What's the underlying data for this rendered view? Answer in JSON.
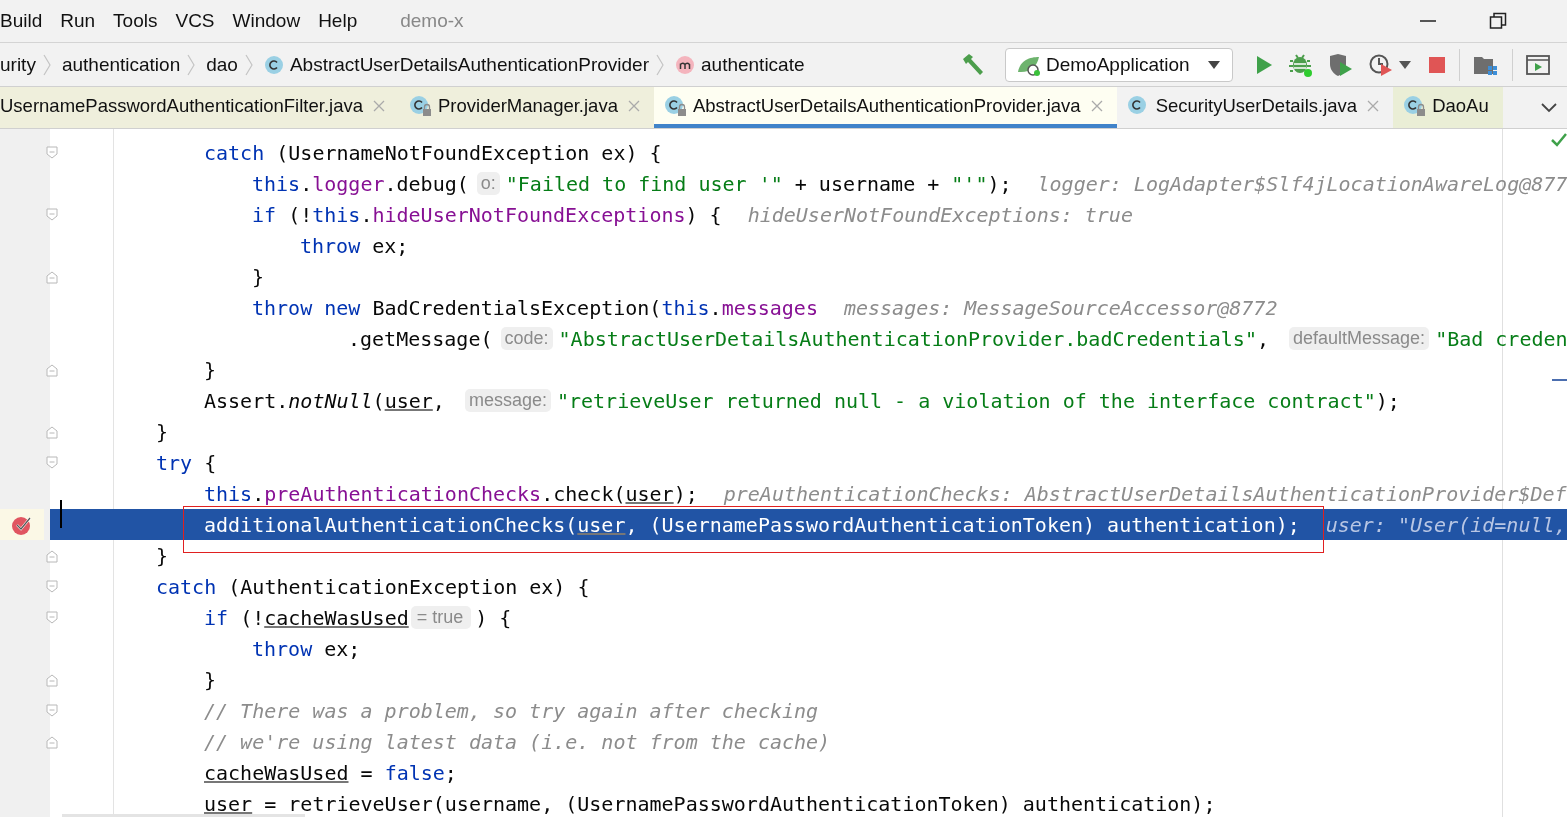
{
  "menu": {
    "items": [
      "Build",
      "Run",
      "Tools",
      "VCS",
      "Window",
      "Help"
    ],
    "project": "demo-x"
  },
  "breadcrumbs": [
    {
      "label": "urity",
      "kind": "package"
    },
    {
      "label": "authentication",
      "kind": "package"
    },
    {
      "label": "dao",
      "kind": "package"
    },
    {
      "label": "AbstractUserDetailsAuthenticationProvider",
      "kind": "class"
    },
    {
      "label": "authenticate",
      "kind": "method"
    }
  ],
  "run_config": "DemoApplication",
  "tabs": [
    {
      "label": "UsernamePasswordAuthenticationFilter.java",
      "selected": false,
      "locked": false,
      "icon": false,
      "color": "#efefdc"
    },
    {
      "label": "ProviderManager.java",
      "selected": false,
      "locked": true,
      "icon": true,
      "color": "#efefdc"
    },
    {
      "label": "AbstractUserDetailsAuthenticationProvider.java",
      "selected": true,
      "locked": true,
      "icon": true,
      "color": "#fefef2"
    },
    {
      "label": "SecurityUserDetails.java",
      "selected": false,
      "locked": false,
      "icon": true,
      "color": "#f2f2f2"
    },
    {
      "label": "DaoAu",
      "selected": false,
      "locked": true,
      "icon": true,
      "color": "#eaeed6"
    }
  ],
  "code": {
    "inner_lines": [
      {
        "foldable": true,
        "tokens": [
          {
            "kind": "keyword",
            "text": "catch"
          },
          {
            "kind": "plain",
            "text": " (UsernameNotFoundException ex) {"
          }
        ],
        "children": [
          {
            "tokens": [
              {
                "kind": "keyword",
                "text": "this"
              },
              {
                "kind": "plain",
                "text": "."
              },
              {
                "kind": "field",
                "text": "logger"
              },
              {
                "kind": "plain",
                "text": ".debug("
              },
              {
                "kind": "param_hint",
                "text": "o:"
              },
              {
                "kind": "string",
                "text": "\"Failed to find user '\""
              },
              {
                "kind": "plain",
                "text": " + username + "
              },
              {
                "kind": "string",
                "text": "\"'\""
              },
              {
                "kind": "plain",
                "text": ");"
              },
              {
                "kind": "debug_value",
                "text": "logger: LogAdapter$Slf4jLocationAwareLog@877"
              }
            ]
          },
          {
            "foldable": true,
            "tokens": [
              {
                "kind": "keyword",
                "text": "if"
              },
              {
                "kind": "plain",
                "text": " (!"
              },
              {
                "kind": "keyword",
                "text": "this"
              },
              {
                "kind": "plain",
                "text": "."
              },
              {
                "kind": "field",
                "text": "hideUserNotFoundExceptions"
              },
              {
                "kind": "plain",
                "text": ") {"
              },
              {
                "kind": "debug_value",
                "text": "hideUserNotFoundExceptions: true"
              }
            ],
            "children": [
              {
                "tokens": [
                  {
                    "kind": "keyword",
                    "text": "throw"
                  },
                  {
                    "kind": "plain",
                    "text": " ex;"
                  }
                ]
              }
            ]
          },
          {
            "block_end": true,
            "tokens": [
              {
                "kind": "plain",
                "text": "}"
              }
            ]
          },
          {
            "tokens": [
              {
                "kind": "keyword",
                "text": "throw new"
              },
              {
                "kind": "plain",
                "text": " BadCredentialsException("
              },
              {
                "kind": "keyword",
                "text": "this"
              },
              {
                "kind": "plain",
                "text": "."
              },
              {
                "kind": "field",
                "text": "messages"
              },
              {
                "kind": "debug_value",
                "text": "messages: MessageSourceAccessor@8772"
              }
            ],
            "children": [
              {
                "continuation": true,
                "tokens": [
                  {
                    "kind": "plain",
                    "text": ".getMessage("
                  },
                  {
                    "kind": "param_hint",
                    "text": "code:"
                  },
                  {
                    "kind": "string",
                    "text": "\"AbstractUserDetailsAuthenticationProvider.badCredentials\""
                  },
                  {
                    "kind": "plain",
                    "text": ", "
                  },
                  {
                    "kind": "param_hint",
                    "text": "defaultMessage:"
                  },
                  {
                    "kind": "string",
                    "text": "\"Bad creden"
                  }
                ]
              }
            ]
          }
        ]
      },
      {
        "block_end": true,
        "tokens": [
          {
            "kind": "plain",
            "text": "}"
          }
        ]
      },
      {
        "tokens": [
          {
            "kind": "plain",
            "text": "Assert."
          },
          {
            "kind": "static",
            "text": "notNull"
          },
          {
            "kind": "plain",
            "text": "("
          },
          {
            "kind": "local",
            "text": "user"
          },
          {
            "kind": "plain",
            "text": ", "
          },
          {
            "kind": "param_hint",
            "text": "message:"
          },
          {
            "kind": "string",
            "text": "\"retrieveUser returned null - a violation of the interface contract\""
          },
          {
            "kind": "plain",
            "text": ");"
          }
        ]
      }
    ],
    "lines": [
      {
        "block_end": true,
        "tokens": [
          {
            "kind": "plain",
            "text": "}"
          }
        ]
      },
      {
        "foldable": true,
        "tokens": [
          {
            "kind": "keyword",
            "text": "try"
          },
          {
            "kind": "plain",
            "text": " {"
          }
        ],
        "children": [
          {
            "tokens": [
              {
                "kind": "keyword",
                "text": "this"
              },
              {
                "kind": "plain",
                "text": "."
              },
              {
                "kind": "field",
                "text": "preAuthenticationChecks"
              },
              {
                "kind": "plain",
                "text": ".check("
              },
              {
                "kind": "local",
                "text": "user"
              },
              {
                "kind": "plain",
                "text": ");"
              },
              {
                "kind": "debug_value",
                "text": "preAuthenticationChecks: AbstractUserDetailsAuthenticationProvider$Def"
              }
            ]
          },
          {
            "selected": true,
            "breakpoint": true,
            "boxed": true,
            "tokens": [
              {
                "kind": "plain",
                "text": "additionalAuthenticationChecks("
              },
              {
                "kind": "local",
                "text": "user"
              },
              {
                "kind": "plain",
                "text": ", (UsernamePasswordAuthenticationToken) authentication);"
              },
              {
                "kind": "debug_value",
                "text": "user: \"User(id=null,"
              }
            ]
          }
        ]
      },
      {
        "block_end": true,
        "tokens": [
          {
            "kind": "plain",
            "text": "}"
          }
        ]
      },
      {
        "foldable": true,
        "tokens": [
          {
            "kind": "keyword",
            "text": "catch"
          },
          {
            "kind": "plain",
            "text": " (AuthenticationException ex) {"
          }
        ],
        "children": [
          {
            "foldable": true,
            "tokens": [
              {
                "kind": "keyword",
                "text": "if"
              },
              {
                "kind": "plain",
                "text": " (!"
              },
              {
                "kind": "local",
                "text": "cacheWasUsed"
              },
              {
                "kind": "value_hint",
                "text": "= true"
              },
              {
                "kind": "plain",
                "text": ") {"
              }
            ],
            "children": [
              {
                "tokens": [
                  {
                    "kind": "keyword",
                    "text": "throw"
                  },
                  {
                    "kind": "plain",
                    "text": " ex;"
                  }
                ]
              }
            ]
          },
          {
            "block_end": true,
            "tokens": [
              {
                "kind": "plain",
                "text": "}"
              }
            ]
          },
          {
            "foldable": true,
            "tokens": [
              {
                "kind": "comment",
                "text": "// There was a problem, so try again after checking"
              }
            ]
          },
          {
            "block_end": true,
            "tokens": [
              {
                "kind": "comment",
                "text": "// we're using latest data (i.e. not from the cache)"
              }
            ]
          },
          {
            "tokens": [
              {
                "kind": "local",
                "text": "cacheWasUsed"
              },
              {
                "kind": "plain",
                "text": " = "
              },
              {
                "kind": "keyword",
                "text": "false"
              },
              {
                "kind": "plain",
                "text": ";"
              }
            ]
          },
          {
            "tokens": [
              {
                "kind": "local",
                "text": "user"
              },
              {
                "kind": "plain",
                "text": " = retrieveUser(username, (UsernamePasswordAuthenticationToken) authentication);"
              }
            ]
          }
        ]
      }
    ]
  }
}
